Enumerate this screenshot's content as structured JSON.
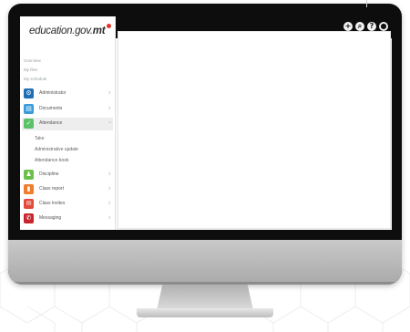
{
  "brand": {
    "logo_text": "education.gov.",
    "logo_suffix": "mt"
  },
  "top_icons": [
    {
      "name": "add-icon",
      "glyph": "+"
    },
    {
      "name": "search-icon",
      "glyph": "⌕"
    },
    {
      "name": "help-icon",
      "glyph": "?"
    },
    {
      "name": "user-icon",
      "glyph": "●"
    }
  ],
  "sidebar": {
    "overview": "Overview",
    "my_files": "My files",
    "my_schedule": "My schedule",
    "items": [
      {
        "label": "Administrator",
        "color": "#1f6fb5",
        "icon": "gear-icon",
        "glyph": "⚙",
        "expanded": false
      },
      {
        "label": "Documents",
        "color": "#3a9bd9",
        "icon": "document-icon",
        "glyph": "▤",
        "expanded": false
      },
      {
        "label": "Attendance",
        "color": "#5cc26a",
        "icon": "check-icon",
        "glyph": "✓",
        "expanded": true
      },
      {
        "label": "Discipline",
        "color": "#6cc04a",
        "icon": "person-icon",
        "glyph": "♟",
        "expanded": false
      },
      {
        "label": "Class report",
        "color": "#f07c2d",
        "icon": "bookmark-icon",
        "glyph": "▮",
        "expanded": false
      },
      {
        "label": "Class Invites",
        "color": "#e24b3b",
        "icon": "invite-icon",
        "glyph": "✉",
        "expanded": false
      },
      {
        "label": "Messaging",
        "color": "#c8242c",
        "icon": "message-icon",
        "glyph": "✆",
        "expanded": false
      }
    ],
    "attendance_sub": [
      "Take",
      "Administrative update",
      "Attendance book"
    ]
  }
}
